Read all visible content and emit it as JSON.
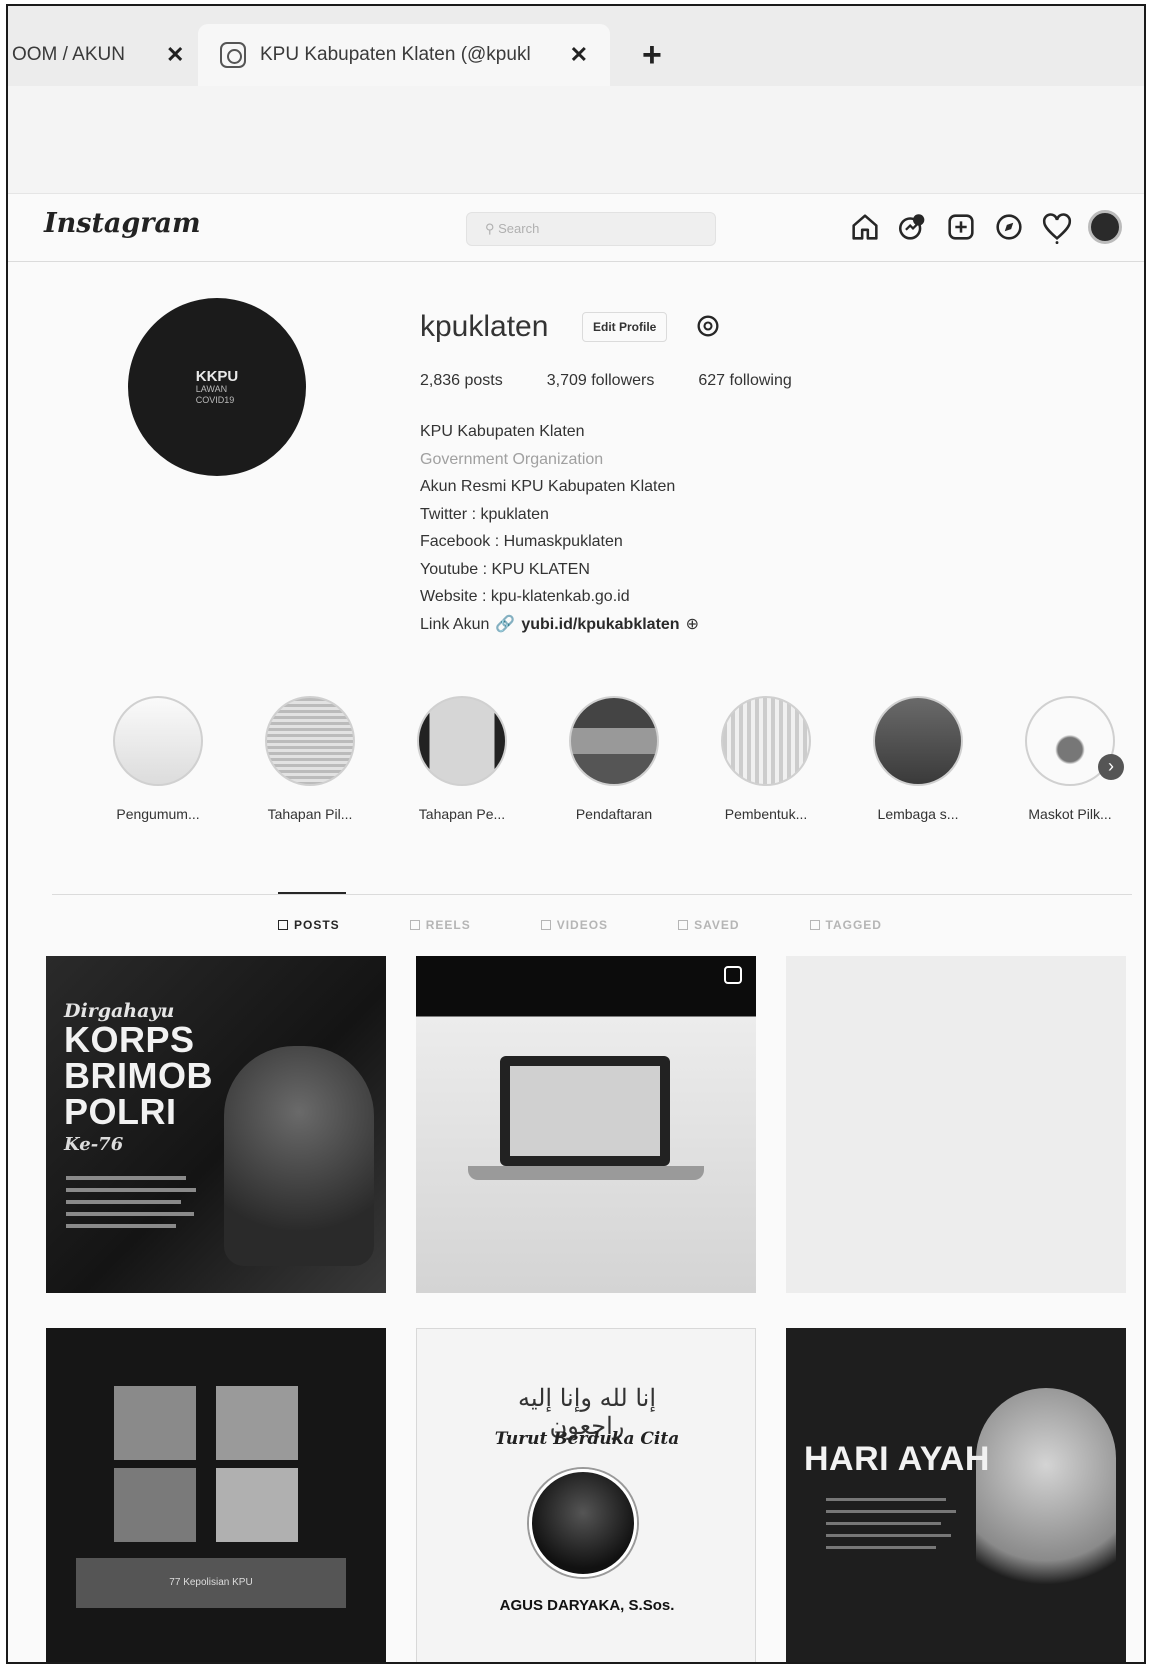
{
  "browser": {
    "tabs": [
      {
        "label": "OOM / AKUN",
        "active": false
      },
      {
        "label": "KPU Kabupaten Klaten (@kpukl",
        "active": true
      }
    ],
    "close_glyph": "✕",
    "new_tab_glyph": "+"
  },
  "instagram": {
    "logo": "Instagram",
    "search_placeholder": "Search",
    "nav_icons": [
      "home-icon",
      "messenger-icon",
      "new-post-icon",
      "explore-icon",
      "activity-heart-icon",
      "profile-avatar-icon"
    ]
  },
  "profile": {
    "username": "kpuklaten",
    "edit_button": "Edit Profile",
    "stats": {
      "posts": "2,836 posts",
      "followers": "3,709 followers",
      "following": "627 following"
    },
    "avatar_text": {
      "line1": "KKPU",
      "line2": "LAWAN",
      "line3": "COVID19"
    },
    "bio": {
      "name": "KPU Kabupaten Klaten",
      "category": "Government Organization",
      "lines": [
        "Akun Resmi KPU Kabupaten Klaten",
        "Twitter : kpuklaten",
        "Facebook : Humaskpuklaten",
        "Youtube : KPU KLATEN",
        "Website : kpu-klatenkab.go.id"
      ],
      "link_prefix": "Link Akun",
      "link_url": "yubi.id/kpukabklaten"
    }
  },
  "highlights": [
    {
      "label": "Pengumum..."
    },
    {
      "label": "Tahapan Pil..."
    },
    {
      "label": "Tahapan Pe..."
    },
    {
      "label": "Pendaftaran"
    },
    {
      "label": "Pembentuk..."
    },
    {
      "label": "Lembaga s..."
    },
    {
      "label": "Maskot Pilk..."
    }
  ],
  "profile_tabs": [
    {
      "label": "POSTS",
      "active": true
    },
    {
      "label": "REELS",
      "active": false
    },
    {
      "label": "VIDEOS",
      "active": false
    },
    {
      "label": "SAVED",
      "active": false
    },
    {
      "label": "TAGGED",
      "active": false
    }
  ],
  "posts": {
    "p1": {
      "line1": "Dirgahayu",
      "line2": "KORPS",
      "line3": "BRIMOB",
      "line4": "POLRI",
      "line5": "Ke-76"
    },
    "p4": {
      "caption": "77 Kepolisian KPU"
    },
    "p5": {
      "arabic": "إنا لله وإنا إليه راجعون",
      "script": "Turut Berduka Cita",
      "name": "AGUS DARYAKA, S.Sos."
    },
    "p6": {
      "title": "HARI AYAH"
    }
  }
}
